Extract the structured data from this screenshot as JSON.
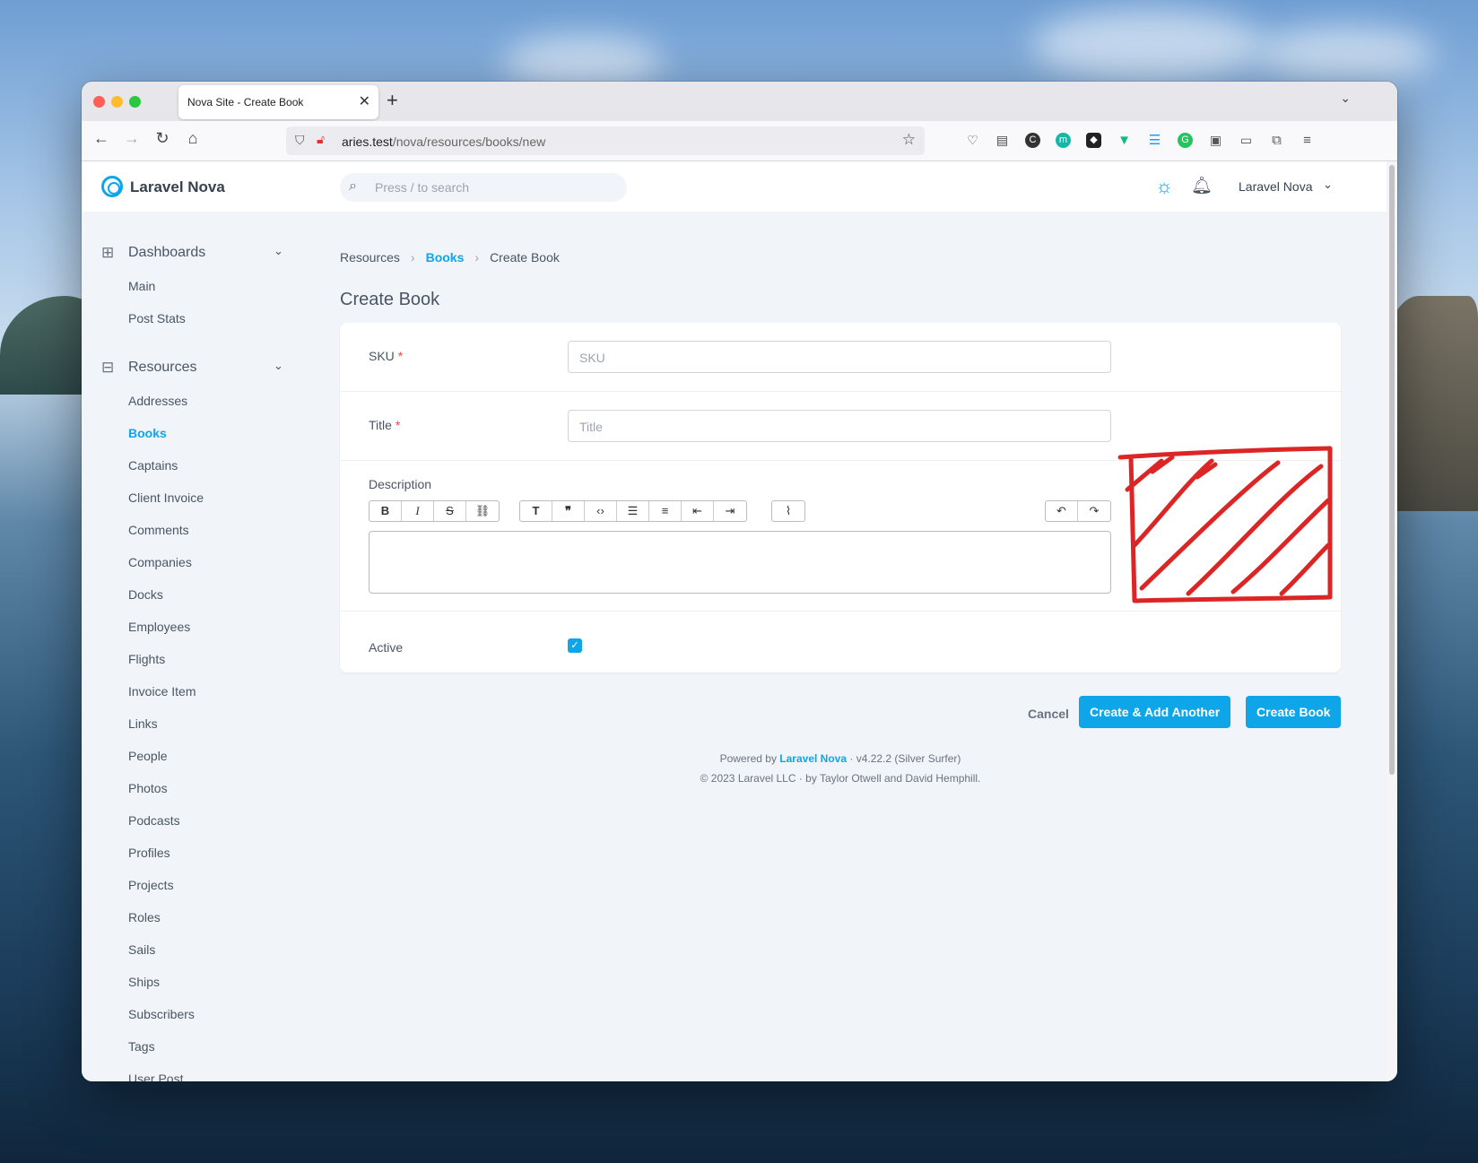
{
  "browser": {
    "tab_title": "Nova Site - Create Book",
    "url_host": "aries.test",
    "url_path": "/nova/resources/books/new"
  },
  "header": {
    "brand": "Laravel Nova",
    "search_placeholder": "Press / to search",
    "user_menu": "Laravel Nova"
  },
  "sidebar": {
    "dashboards_title": "Dashboards",
    "dashboards": [
      "Main",
      "Post Stats"
    ],
    "resources_title": "Resources",
    "resources": [
      "Addresses",
      "Books",
      "Captains",
      "Client Invoice",
      "Comments",
      "Companies",
      "Docks",
      "Employees",
      "Flights",
      "Invoice Item",
      "Links",
      "People",
      "Photos",
      "Podcasts",
      "Profiles",
      "Projects",
      "Roles",
      "Sails",
      "Ships",
      "Subscribers",
      "Tags",
      "User Post"
    ],
    "active": "Books"
  },
  "breadcrumb": {
    "items": [
      "Resources",
      "Books",
      "Create Book"
    ]
  },
  "page": {
    "title": "Create Book"
  },
  "form": {
    "sku_label": "SKU",
    "sku_placeholder": "SKU",
    "title_label": "Title",
    "title_placeholder": "Title",
    "description_label": "Description",
    "active_label": "Active",
    "required_mark": "*",
    "active_checked": true
  },
  "actions": {
    "cancel": "Cancel",
    "create_another": "Create & Add Another",
    "create": "Create Book"
  },
  "footer": {
    "powered_by": "Powered by",
    "brand_link": "Laravel Nova",
    "version": "· v4.22.2 (Silver Surfer)",
    "copyright": "© 2023 Laravel LLC · by Taylor Otwell and David Hemphill."
  },
  "colors": {
    "accent": "#0ea5e9",
    "scribble": "#dc2626"
  }
}
